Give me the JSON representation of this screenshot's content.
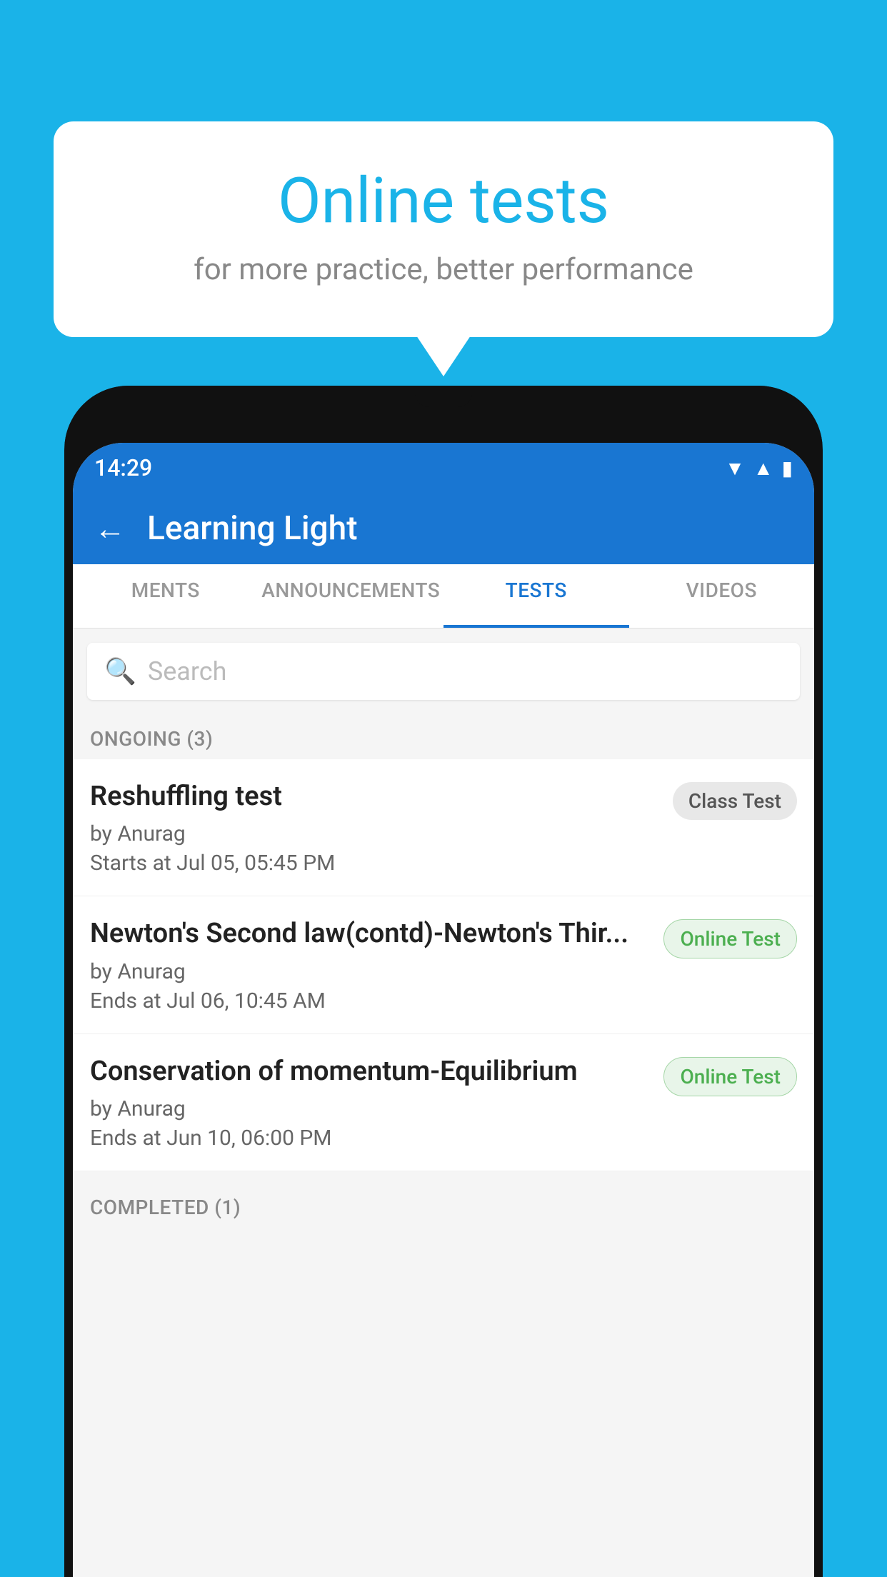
{
  "background": {
    "color": "#1ab3e8"
  },
  "bubble": {
    "title": "Online tests",
    "subtitle": "for more practice, better performance"
  },
  "status_bar": {
    "time": "14:29",
    "icons": [
      "wifi",
      "signal",
      "battery"
    ]
  },
  "app_header": {
    "title": "Learning Light",
    "back_label": "←"
  },
  "tabs": [
    {
      "label": "MENTS",
      "active": false
    },
    {
      "label": "ANNOUNCEMENTS",
      "active": false
    },
    {
      "label": "TESTS",
      "active": true
    },
    {
      "label": "VIDEOS",
      "active": false
    }
  ],
  "search": {
    "placeholder": "Search"
  },
  "ongoing_section": {
    "label": "ONGOING (3)"
  },
  "tests": [
    {
      "name": "Reshuffling test",
      "author": "by Anurag",
      "time_label": "Starts at",
      "time": "Jul 05, 05:45 PM",
      "badge": "Class Test",
      "badge_type": "class"
    },
    {
      "name": "Newton's Second law(contd)-Newton's Thir...",
      "author": "by Anurag",
      "time_label": "Ends at",
      "time": "Jul 06, 10:45 AM",
      "badge": "Online Test",
      "badge_type": "online"
    },
    {
      "name": "Conservation of momentum-Equilibrium",
      "author": "by Anurag",
      "time_label": "Ends at",
      "time": "Jun 10, 06:00 PM",
      "badge": "Online Test",
      "badge_type": "online"
    }
  ],
  "completed_section": {
    "label": "COMPLETED (1)"
  }
}
